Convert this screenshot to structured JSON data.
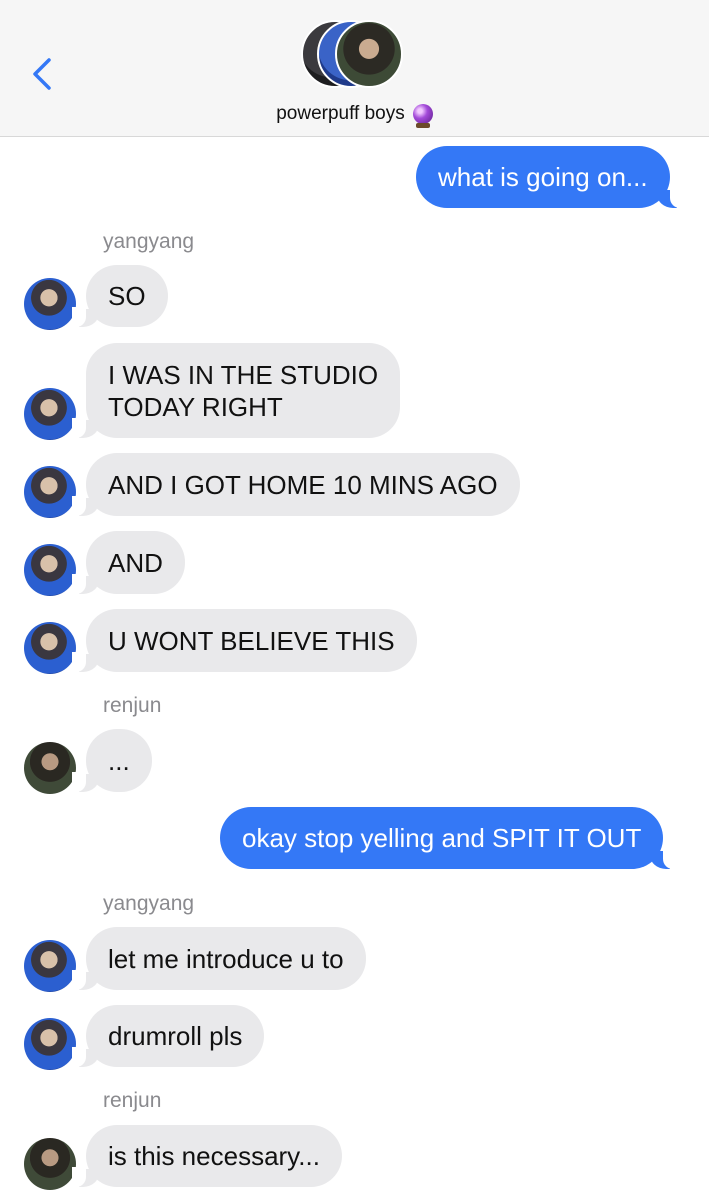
{
  "header": {
    "back_icon": "chevron-left-icon",
    "title": "powerpuff boys",
    "title_icon": "crystal-ball-icon",
    "accent_color": "#3478f6"
  },
  "messages": [
    {
      "type": "outgoing",
      "text": "what is going on..."
    },
    {
      "type": "sender",
      "text": "yangyang"
    },
    {
      "type": "incoming",
      "sender": "yangyang",
      "text": "SO"
    },
    {
      "type": "incoming",
      "sender": "yangyang",
      "lines": [
        "I WAS IN THE STUDIO",
        "TODAY RIGHT"
      ]
    },
    {
      "type": "incoming",
      "sender": "yangyang",
      "text": "AND I GOT HOME 10 MINS AGO"
    },
    {
      "type": "incoming",
      "sender": "yangyang",
      "text": "AND"
    },
    {
      "type": "incoming",
      "sender": "yangyang",
      "text": "U WONT BELIEVE THIS"
    },
    {
      "type": "sender",
      "text": "renjun"
    },
    {
      "type": "incoming",
      "sender": "renjun",
      "text": "..."
    },
    {
      "type": "outgoing",
      "text": "okay stop yelling and SPIT IT OUT"
    },
    {
      "type": "sender",
      "text": "yangyang"
    },
    {
      "type": "incoming",
      "sender": "yangyang",
      "text": "let me introduce u to"
    },
    {
      "type": "incoming",
      "sender": "yangyang",
      "text": "drumroll pls"
    },
    {
      "type": "sender",
      "text": "renjun"
    },
    {
      "type": "incoming",
      "sender": "renjun",
      "text": "is this necessary..."
    }
  ]
}
